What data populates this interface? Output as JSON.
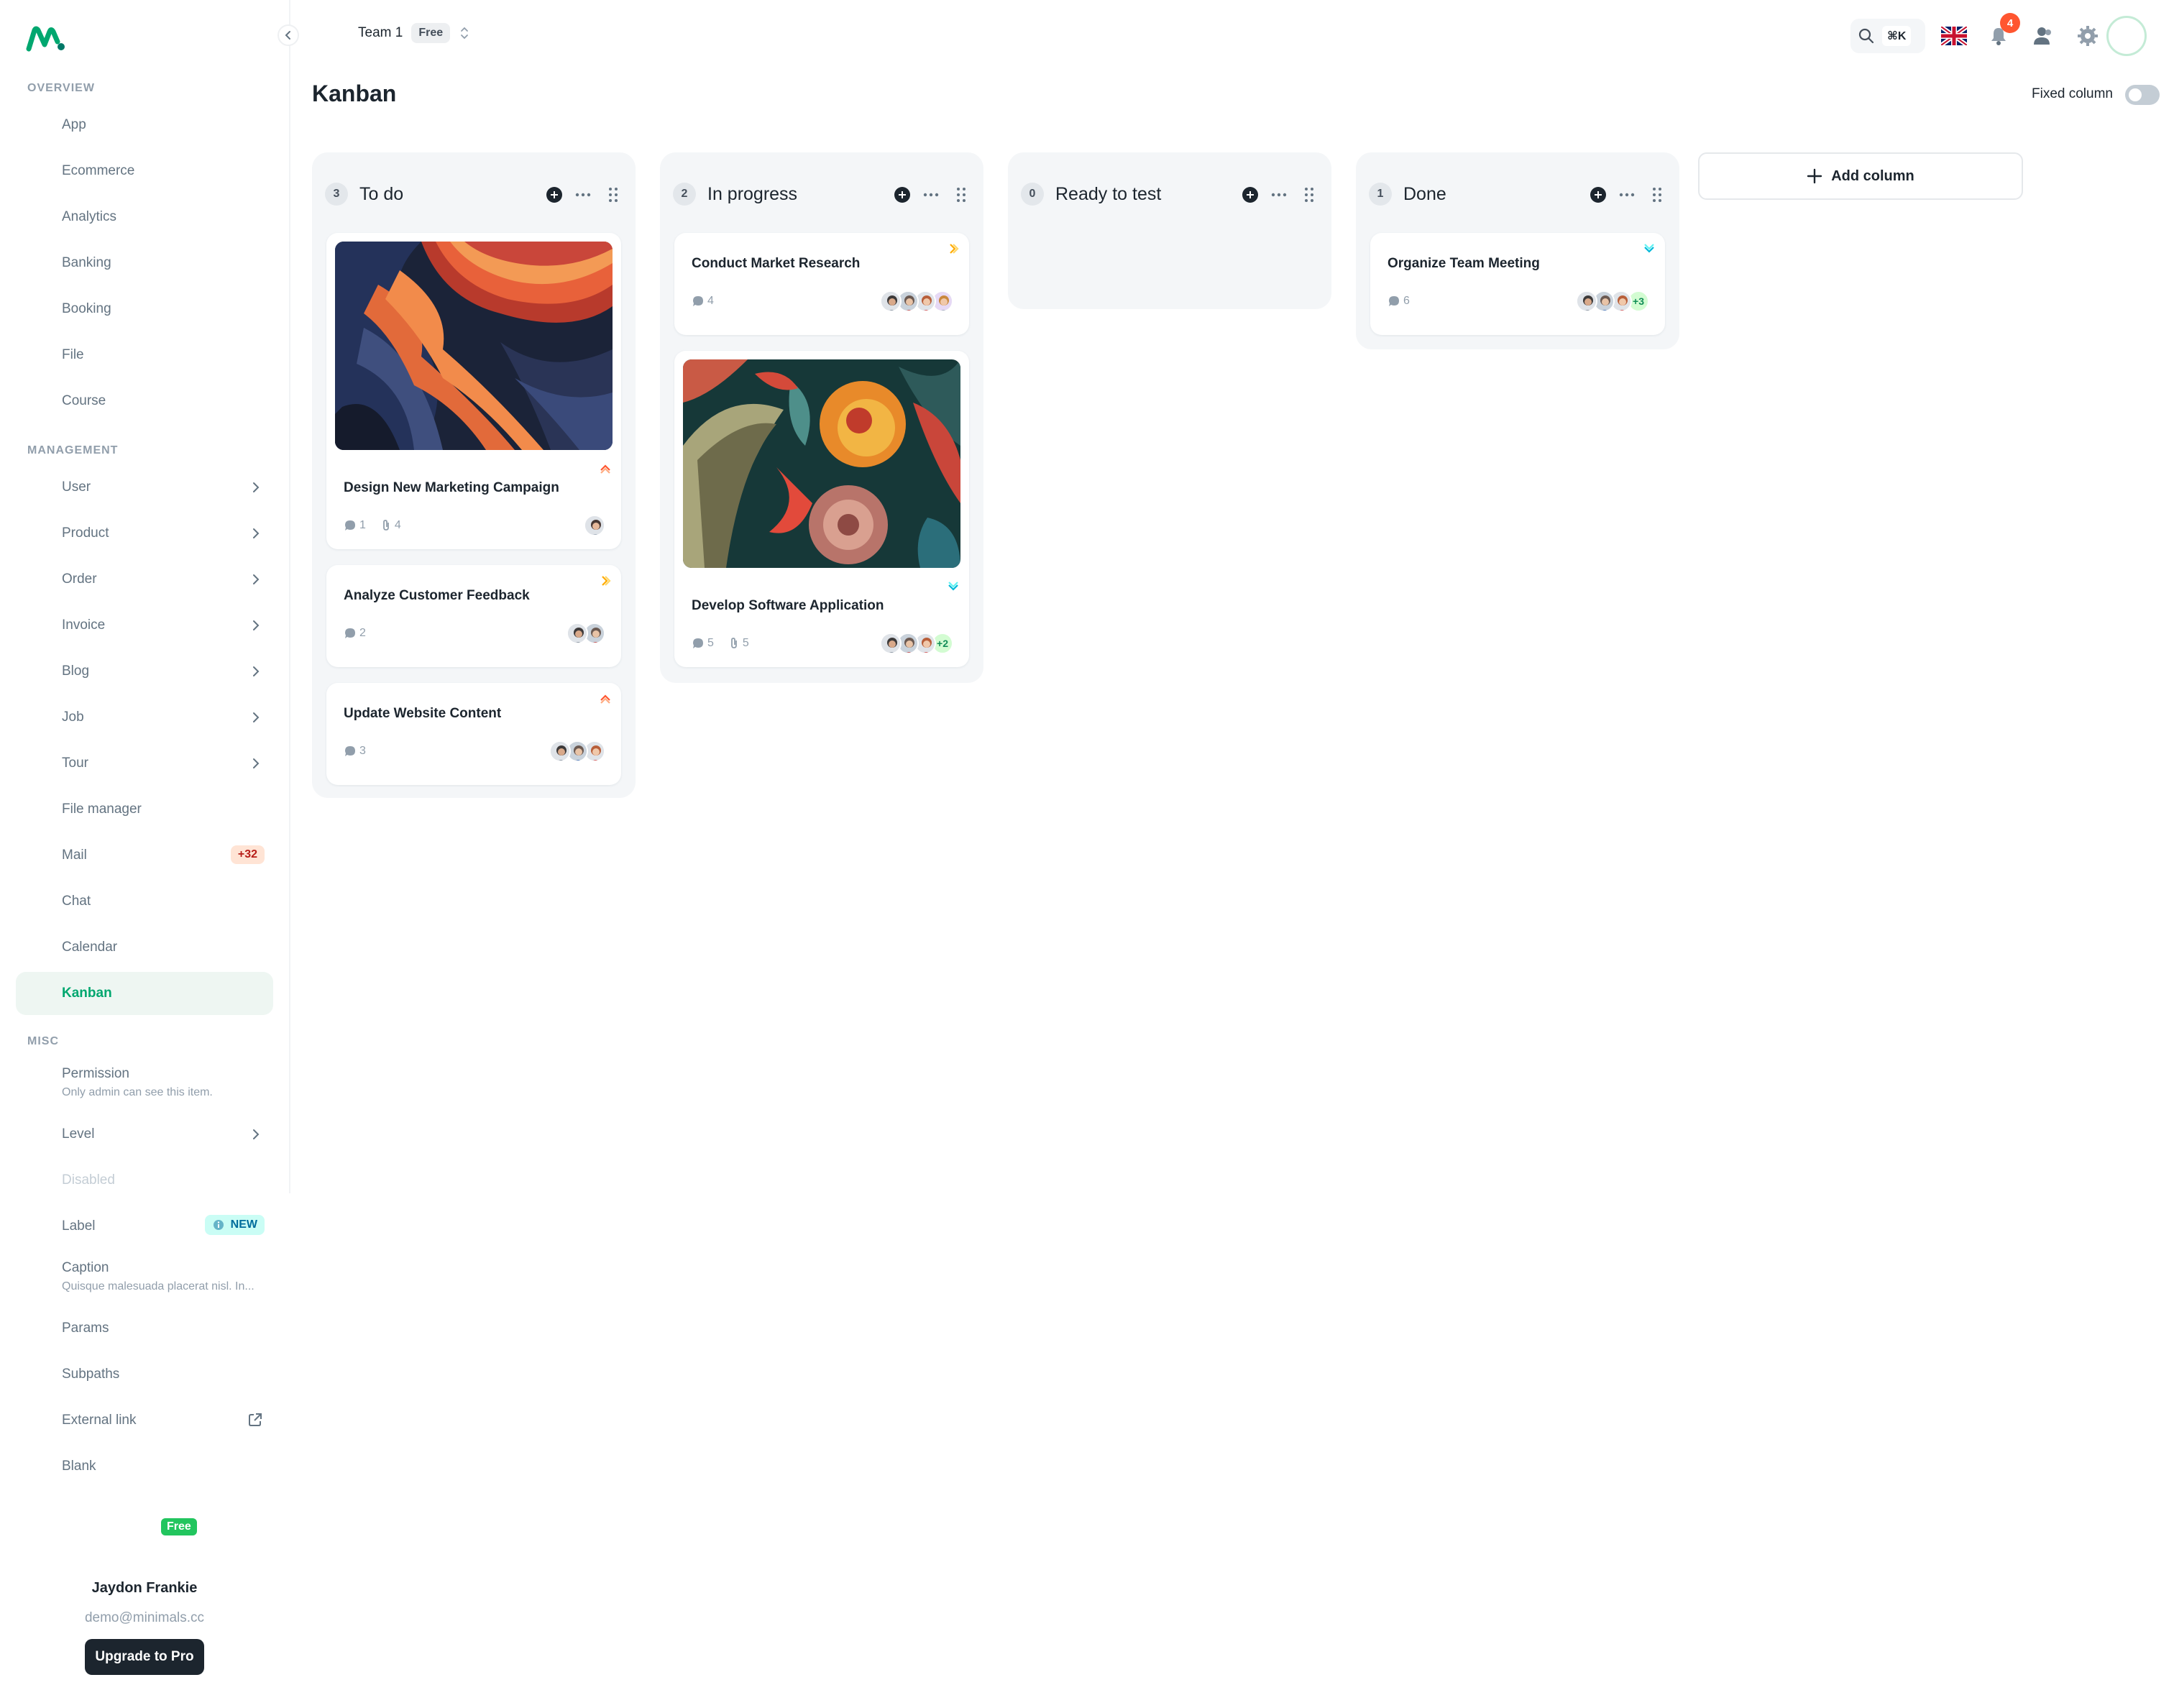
{
  "header": {
    "team_name": "Team 1",
    "team_plan": "Free",
    "search_shortcut": "⌘K",
    "notification_count": "4"
  },
  "sidebar": {
    "sections": {
      "overview": "OVERVIEW",
      "management": "MANAGEMENT",
      "misc": "MISC"
    },
    "overview_items": [
      "App",
      "Ecommerce",
      "Analytics",
      "Banking",
      "Booking",
      "File",
      "Course"
    ],
    "management_items": [
      "User",
      "Product",
      "Order",
      "Invoice",
      "Blog",
      "Job",
      "Tour",
      "File manager",
      "Mail",
      "Chat",
      "Calendar",
      "Kanban"
    ],
    "mail_badge": "+32",
    "misc": {
      "permission": "Permission",
      "permission_caption": "Only admin can see this item.",
      "level": "Level",
      "disabled": "Disabled",
      "label": "Label",
      "label_badge": "NEW",
      "caption": "Caption",
      "caption_sub": "Quisque malesuada placerat nisl. In...",
      "params": "Params",
      "subpaths": "Subpaths",
      "external_link": "External link",
      "blank": "Blank"
    },
    "footer": {
      "plan_chip": "Free",
      "user_name": "Jaydon Frankie",
      "user_email": "demo@minimals.cc",
      "upgrade_label": "Upgrade to Pro"
    }
  },
  "main": {
    "title": "Kanban",
    "fixed_column_label": "Fixed column",
    "add_column_label": "Add column",
    "columns": [
      {
        "name": "To do",
        "count": "3",
        "cards": [
          {
            "title": "Design New Marketing Campaign",
            "comments": "1",
            "attachments": "4",
            "priority": "high"
          },
          {
            "title": "Analyze Customer Feedback",
            "comments": "2",
            "priority": "medium"
          },
          {
            "title": "Update Website Content",
            "comments": "3",
            "priority": "high"
          }
        ]
      },
      {
        "name": "In progress",
        "count": "2",
        "cards": [
          {
            "title": "Conduct Market Research",
            "comments": "4",
            "priority": "medium"
          },
          {
            "title": "Develop Software Application",
            "comments": "5",
            "attachments": "5",
            "extra_assignees": "+2",
            "priority": "low"
          }
        ]
      },
      {
        "name": "Ready to test",
        "count": "0",
        "cards": []
      },
      {
        "name": "Done",
        "count": "1",
        "cards": [
          {
            "title": "Organize Team Meeting",
            "comments": "6",
            "extra_assignees": "+3",
            "priority": "low"
          }
        ]
      }
    ]
  },
  "colors": {
    "primary": "#00A76F",
    "dark": "#1C252E",
    "priority_high": "#FF5630",
    "priority_medium": "#FFAB00",
    "priority_low": "#00B8D9"
  }
}
